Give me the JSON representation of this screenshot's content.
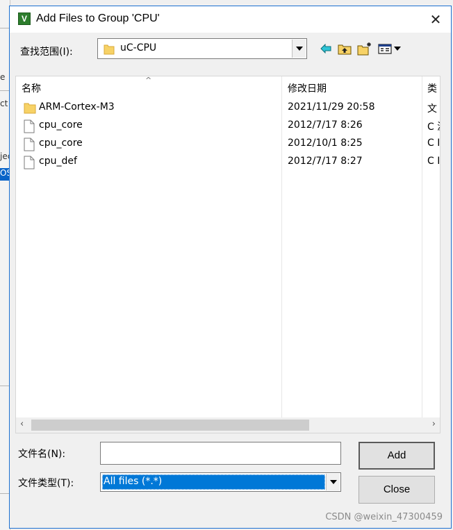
{
  "background_app": {
    "fragments": [
      "e",
      "ct",
      "jec",
      "OS"
    ]
  },
  "dialog": {
    "title": "Add Files to Group 'CPU'",
    "app_icon_letter": "V",
    "close_glyph": "✕"
  },
  "look_in": {
    "label": "查找范围(I):",
    "value": "uC-CPU"
  },
  "toolbar": {
    "icons": [
      "back-icon",
      "up-folder-icon",
      "new-folder-icon",
      "view-menu-icon"
    ]
  },
  "file_list": {
    "columns": [
      "名称",
      "修改日期",
      "类"
    ],
    "rows": [
      {
        "name": "ARM-Cortex-M3",
        "date": "2021/11/29 20:58",
        "type": "文",
        "kind": "folder"
      },
      {
        "name": "cpu_core",
        "date": "2012/7/17 8:26",
        "type": "C 源",
        "kind": "file"
      },
      {
        "name": "cpu_core",
        "date": "2012/10/1 8:25",
        "type": "C I",
        "kind": "file"
      },
      {
        "name": "cpu_def",
        "date": "2012/7/17 8:27",
        "type": "C I",
        "kind": "file"
      }
    ]
  },
  "file_name": {
    "label": "文件名(N):",
    "value": ""
  },
  "file_type": {
    "label": "文件类型(T):",
    "value": "All files (*.*)"
  },
  "buttons": {
    "add": "Add",
    "close": "Close"
  },
  "watermark": "CSDN @weixin_47300459",
  "colors": {
    "accent": "#0078d7",
    "folder": "#f7d266",
    "window_border": "#1a6fd1"
  }
}
